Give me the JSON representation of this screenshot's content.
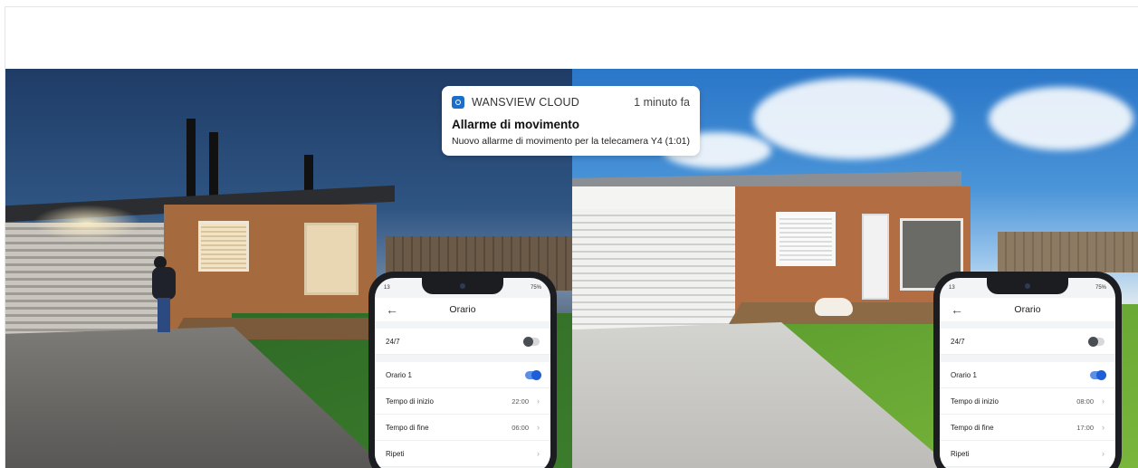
{
  "notification": {
    "app_name": "WANSVIEW CLOUD",
    "time": "1 minuto fa",
    "title": "Allarme di movimento",
    "body": "Nuovo allarme di movimento per la telecamera Y4 (1:01)",
    "icon": "camera-app-icon"
  },
  "phone_left": {
    "status_time": "13",
    "battery": "75%",
    "title": "Orario",
    "always_label": "24/7",
    "always_on": false,
    "schedule_label": "Orario 1",
    "schedule_on": true,
    "start_label": "Tempo di inizio",
    "start_value": "22:00",
    "end_label": "Tempo di fine",
    "end_value": "06:00",
    "repeat_label": "Ripeti"
  },
  "phone_right": {
    "status_time": "13",
    "battery": "75%",
    "title": "Orario",
    "always_label": "24/7",
    "always_on": false,
    "schedule_label": "Orario 1",
    "schedule_on": true,
    "start_label": "Tempo di inizio",
    "start_value": "08:00",
    "end_label": "Tempo di fine",
    "end_value": "17:00",
    "repeat_label": "Ripeti"
  },
  "colors": {
    "toggle_on": "#1d5fd6",
    "toggle_off": "#4a4d52",
    "notification_icon": "#1b6ec9"
  }
}
